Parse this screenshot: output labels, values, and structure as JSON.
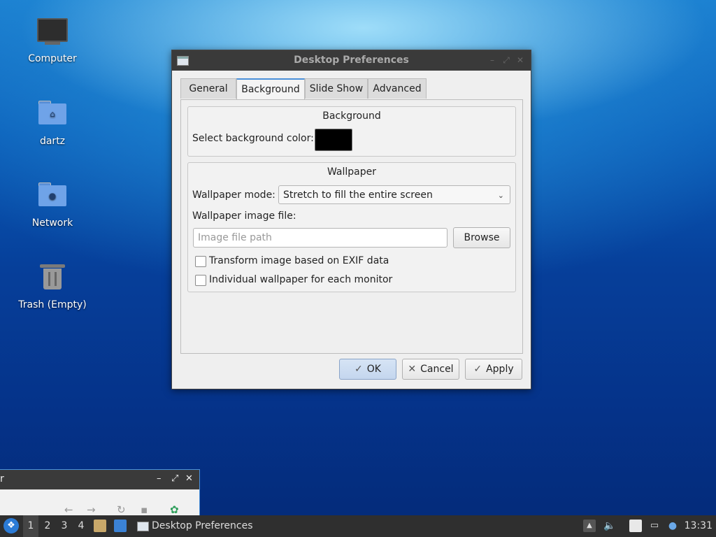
{
  "desktop": {
    "icons": [
      {
        "label": "Computer",
        "icon": "computer-icon"
      },
      {
        "label": "dartz",
        "icon": "home-folder-icon"
      },
      {
        "label": "Network",
        "icon": "network-folder-icon"
      },
      {
        "label": "Trash (Empty)",
        "icon": "trash-icon"
      }
    ]
  },
  "dialog": {
    "title": "Desktop Preferences",
    "tabs": [
      "General",
      "Background",
      "Slide Show",
      "Advanced"
    ],
    "active_tab": "Background",
    "background_group": {
      "title": "Background",
      "color_label": "Select background color:",
      "color_value": "#000000"
    },
    "wallpaper_group": {
      "title": "Wallpaper",
      "mode_label": "Wallpaper mode:",
      "mode_value": "Stretch to fill the entire screen",
      "file_label": "Wallpaper image file:",
      "file_placeholder": "Image file path",
      "file_value": "",
      "browse_label": "Browse",
      "exif_label": "Transform image based on EXIF data",
      "exif_checked": false,
      "monitor_label": "Individual wallpaper for each monitor",
      "monitor_checked": false
    },
    "buttons": {
      "ok": "OK",
      "cancel": "Cancel",
      "apply": "Apply"
    }
  },
  "file_manager": {
    "title_fragment": "r"
  },
  "taskbar": {
    "workspaces": [
      "1",
      "2",
      "3",
      "4"
    ],
    "active_workspace": "1",
    "task_label": "Desktop Preferences",
    "clock": "13:31"
  }
}
